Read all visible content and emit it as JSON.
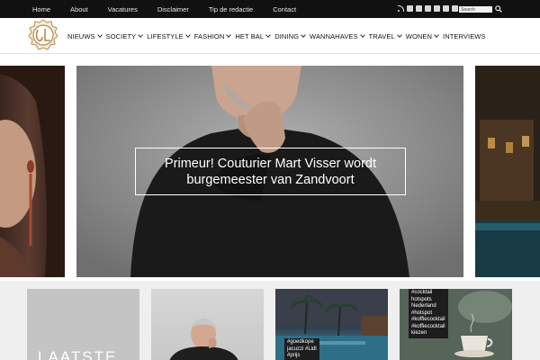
{
  "top_nav": {
    "links": [
      "Home",
      "About",
      "Vacatures",
      "Disclaimer",
      "Tip de redactie",
      "Contact"
    ]
  },
  "social_icons": [
    "rss-icon",
    "facebook-icon",
    "twitter-icon",
    "instagram-icon",
    "vimeo-icon",
    "youtube-icon",
    "pinterest-icon"
  ],
  "search": {
    "placeholder": "Search"
  },
  "main_nav": {
    "items": [
      {
        "label": "NIEUWS",
        "dropdown": true
      },
      {
        "label": "SOCIETY",
        "dropdown": true
      },
      {
        "label": "LIFESTYLE",
        "dropdown": true
      },
      {
        "label": "FASHION",
        "dropdown": true
      },
      {
        "label": "HET BAL",
        "dropdown": true
      },
      {
        "label": "DINING",
        "dropdown": true
      },
      {
        "label": "WANNAHAVES",
        "dropdown": true
      },
      {
        "label": "TRAVEL",
        "dropdown": true
      },
      {
        "label": "WONEN",
        "dropdown": true
      },
      {
        "label": "INTERVIEWS",
        "dropdown": false
      }
    ]
  },
  "hero": {
    "caption": "Primeur! Couturier Mart Visser wordt burgemeester van Zandvoort"
  },
  "cards": {
    "card1_text": "LAATSTE",
    "card3_tags": [
      "#goedkope",
      "jacuzzi #Lidl",
      "#prijs"
    ],
    "card4_tags": [
      "#cocktail",
      "hotspots",
      "Nederland",
      "#hotspot",
      "#koffiecocktail",
      "#koffiecocktail",
      "kiezen"
    ]
  },
  "colors": {
    "topbar_bg": "#111111",
    "nav_text": "#111111",
    "cards_bg": "#efefef",
    "logo_gold": "#b58a4c"
  }
}
